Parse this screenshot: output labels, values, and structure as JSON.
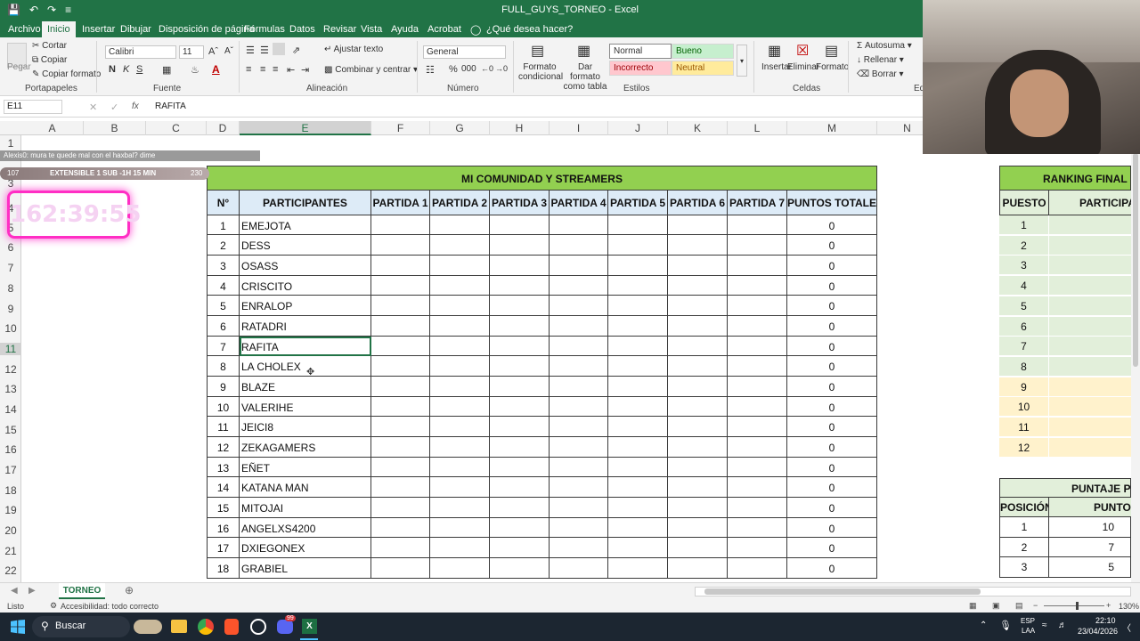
{
  "window": {
    "title": "FULL_GUYS_TORNEO  -  Excel"
  },
  "ribbon_tabs": [
    "Archivo",
    "Inicio",
    "Insertar",
    "Dibujar",
    "Disposición de página",
    "Fórmulas",
    "Datos",
    "Revisar",
    "Vista",
    "Ayuda",
    "Acrobat",
    "¿Qué desea hacer?"
  ],
  "ribbon": {
    "portapapeles": {
      "label": "Portapapeles",
      "pegar": "Pegar",
      "cortar": "Cortar",
      "copiar": "Copiar",
      "copiar_formato": "Copiar formato"
    },
    "fuente": {
      "label": "Fuente",
      "font": "Calibri",
      "size": "11",
      "bold": "N",
      "italic": "K",
      "underline": "S"
    },
    "alineacion": {
      "label": "Alineación",
      "ajustar": "Ajustar texto",
      "combinar": "Combinar y centrar"
    },
    "numero": {
      "label": "Número",
      "format": "General"
    },
    "estilos": {
      "label": "Estilos",
      "formato_condicional": "Formato condicional",
      "dar_formato": "Dar formato como tabla",
      "normal": "Normal",
      "bueno": "Bueno",
      "incorrecto": "Incorrecto",
      "neutral": "Neutral"
    },
    "celdas": {
      "label": "Celdas",
      "insertar": "Insertar",
      "eliminar": "Eliminar",
      "formato": "Formato"
    },
    "edicion": {
      "autosuma": "Autosuma",
      "rellenar": "Rellenar",
      "borrar": "Borrar",
      "label": "Ed"
    }
  },
  "formula_bar": {
    "name_box": "E11",
    "fx": "fx",
    "content": "RAFITA"
  },
  "columns": [
    "A",
    "B",
    "C",
    "D",
    "E",
    "F",
    "G",
    "H",
    "I",
    "J",
    "K",
    "L",
    "M",
    "N"
  ],
  "rows": [
    "1",
    "2",
    "3",
    "4",
    "5",
    "6",
    "7",
    "8",
    "9",
    "10",
    "11",
    "12",
    "13",
    "14",
    "15",
    "16",
    "17",
    "18",
    "19",
    "20",
    "21",
    "22"
  ],
  "table": {
    "title": "MI COMUNIDAD Y STREAMERS",
    "headers": [
      "N°",
      "PARTICIPANTES",
      "PARTIDA 1",
      "PARTIDA 2",
      "PARTIDA 3",
      "PARTIDA 4",
      "PARTIDA 5",
      "PARTIDA 6",
      "PARTIDA 7",
      "PUNTOS TOTALES"
    ],
    "participants": [
      {
        "n": "1",
        "name": "EMEJOTA",
        "total": "0"
      },
      {
        "n": "2",
        "name": "DESS",
        "total": "0"
      },
      {
        "n": "3",
        "name": "OSASS",
        "total": "0"
      },
      {
        "n": "4",
        "name": "CRISCITO",
        "total": "0"
      },
      {
        "n": "5",
        "name": "ENRALOP",
        "total": "0"
      },
      {
        "n": "6",
        "name": "RATADRI",
        "total": "0"
      },
      {
        "n": "7",
        "name": "RAFITA",
        "total": "0"
      },
      {
        "n": "8",
        "name": "LA CHOLEX",
        "total": "0"
      },
      {
        "n": "9",
        "name": "BLAZE",
        "total": "0"
      },
      {
        "n": "10",
        "name": "VALERIHE",
        "total": "0"
      },
      {
        "n": "11",
        "name": "JEICI8",
        "total": "0"
      },
      {
        "n": "12",
        "name": "ZEKAGAMERS",
        "total": "0"
      },
      {
        "n": "13",
        "name": "EÑET",
        "total": "0"
      },
      {
        "n": "14",
        "name": "KATANA MAN",
        "total": "0"
      },
      {
        "n": "15",
        "name": "MITOJAI",
        "total": "0"
      },
      {
        "n": "16",
        "name": "ANGELXS4200",
        "total": "0"
      },
      {
        "n": "17",
        "name": "DXIEGONEX",
        "total": "0"
      },
      {
        "n": "18",
        "name": "GRABIEL",
        "total": "0"
      }
    ]
  },
  "ranking": {
    "title": "RANKING FINAL - T",
    "headers": [
      "PUESTO",
      "PARTICIPA"
    ],
    "positions": [
      "1",
      "2",
      "3",
      "4",
      "5",
      "6",
      "7",
      "8",
      "9",
      "10",
      "11",
      "12"
    ]
  },
  "puntaje": {
    "title": "PUNTAJE PO",
    "headers": [
      "POSICIÓN",
      "PUNTO"
    ],
    "rows": [
      {
        "pos": "1",
        "pts": "10"
      },
      {
        "pos": "2",
        "pts": "7"
      },
      {
        "pos": "3",
        "pts": "5"
      }
    ]
  },
  "overlays": {
    "chat": "Alexis0: mura te quede mal con el haxbal? dime",
    "sub_left": "107",
    "sub_text": "EXTENSIBLE 1 SUB -1H 15 MIN",
    "sub_right": "230",
    "timer": "162:39:55"
  },
  "sheet_tab": "TORNEO",
  "status": {
    "ready": "Listo",
    "accessibility": "Accesibilidad: todo correcto",
    "zoom": "130%"
  },
  "taskbar": {
    "search": "Buscar",
    "lang": "ESP",
    "lang2": "LAA",
    "time": "22:10",
    "date": "23/04/2026",
    "badge": "99"
  },
  "colors": {
    "excel_green": "#217346",
    "header_green": "#92d050",
    "light_green": "#e2efda",
    "light_yellow": "#fff2cc",
    "timer_pink": "#ff2ec4"
  }
}
